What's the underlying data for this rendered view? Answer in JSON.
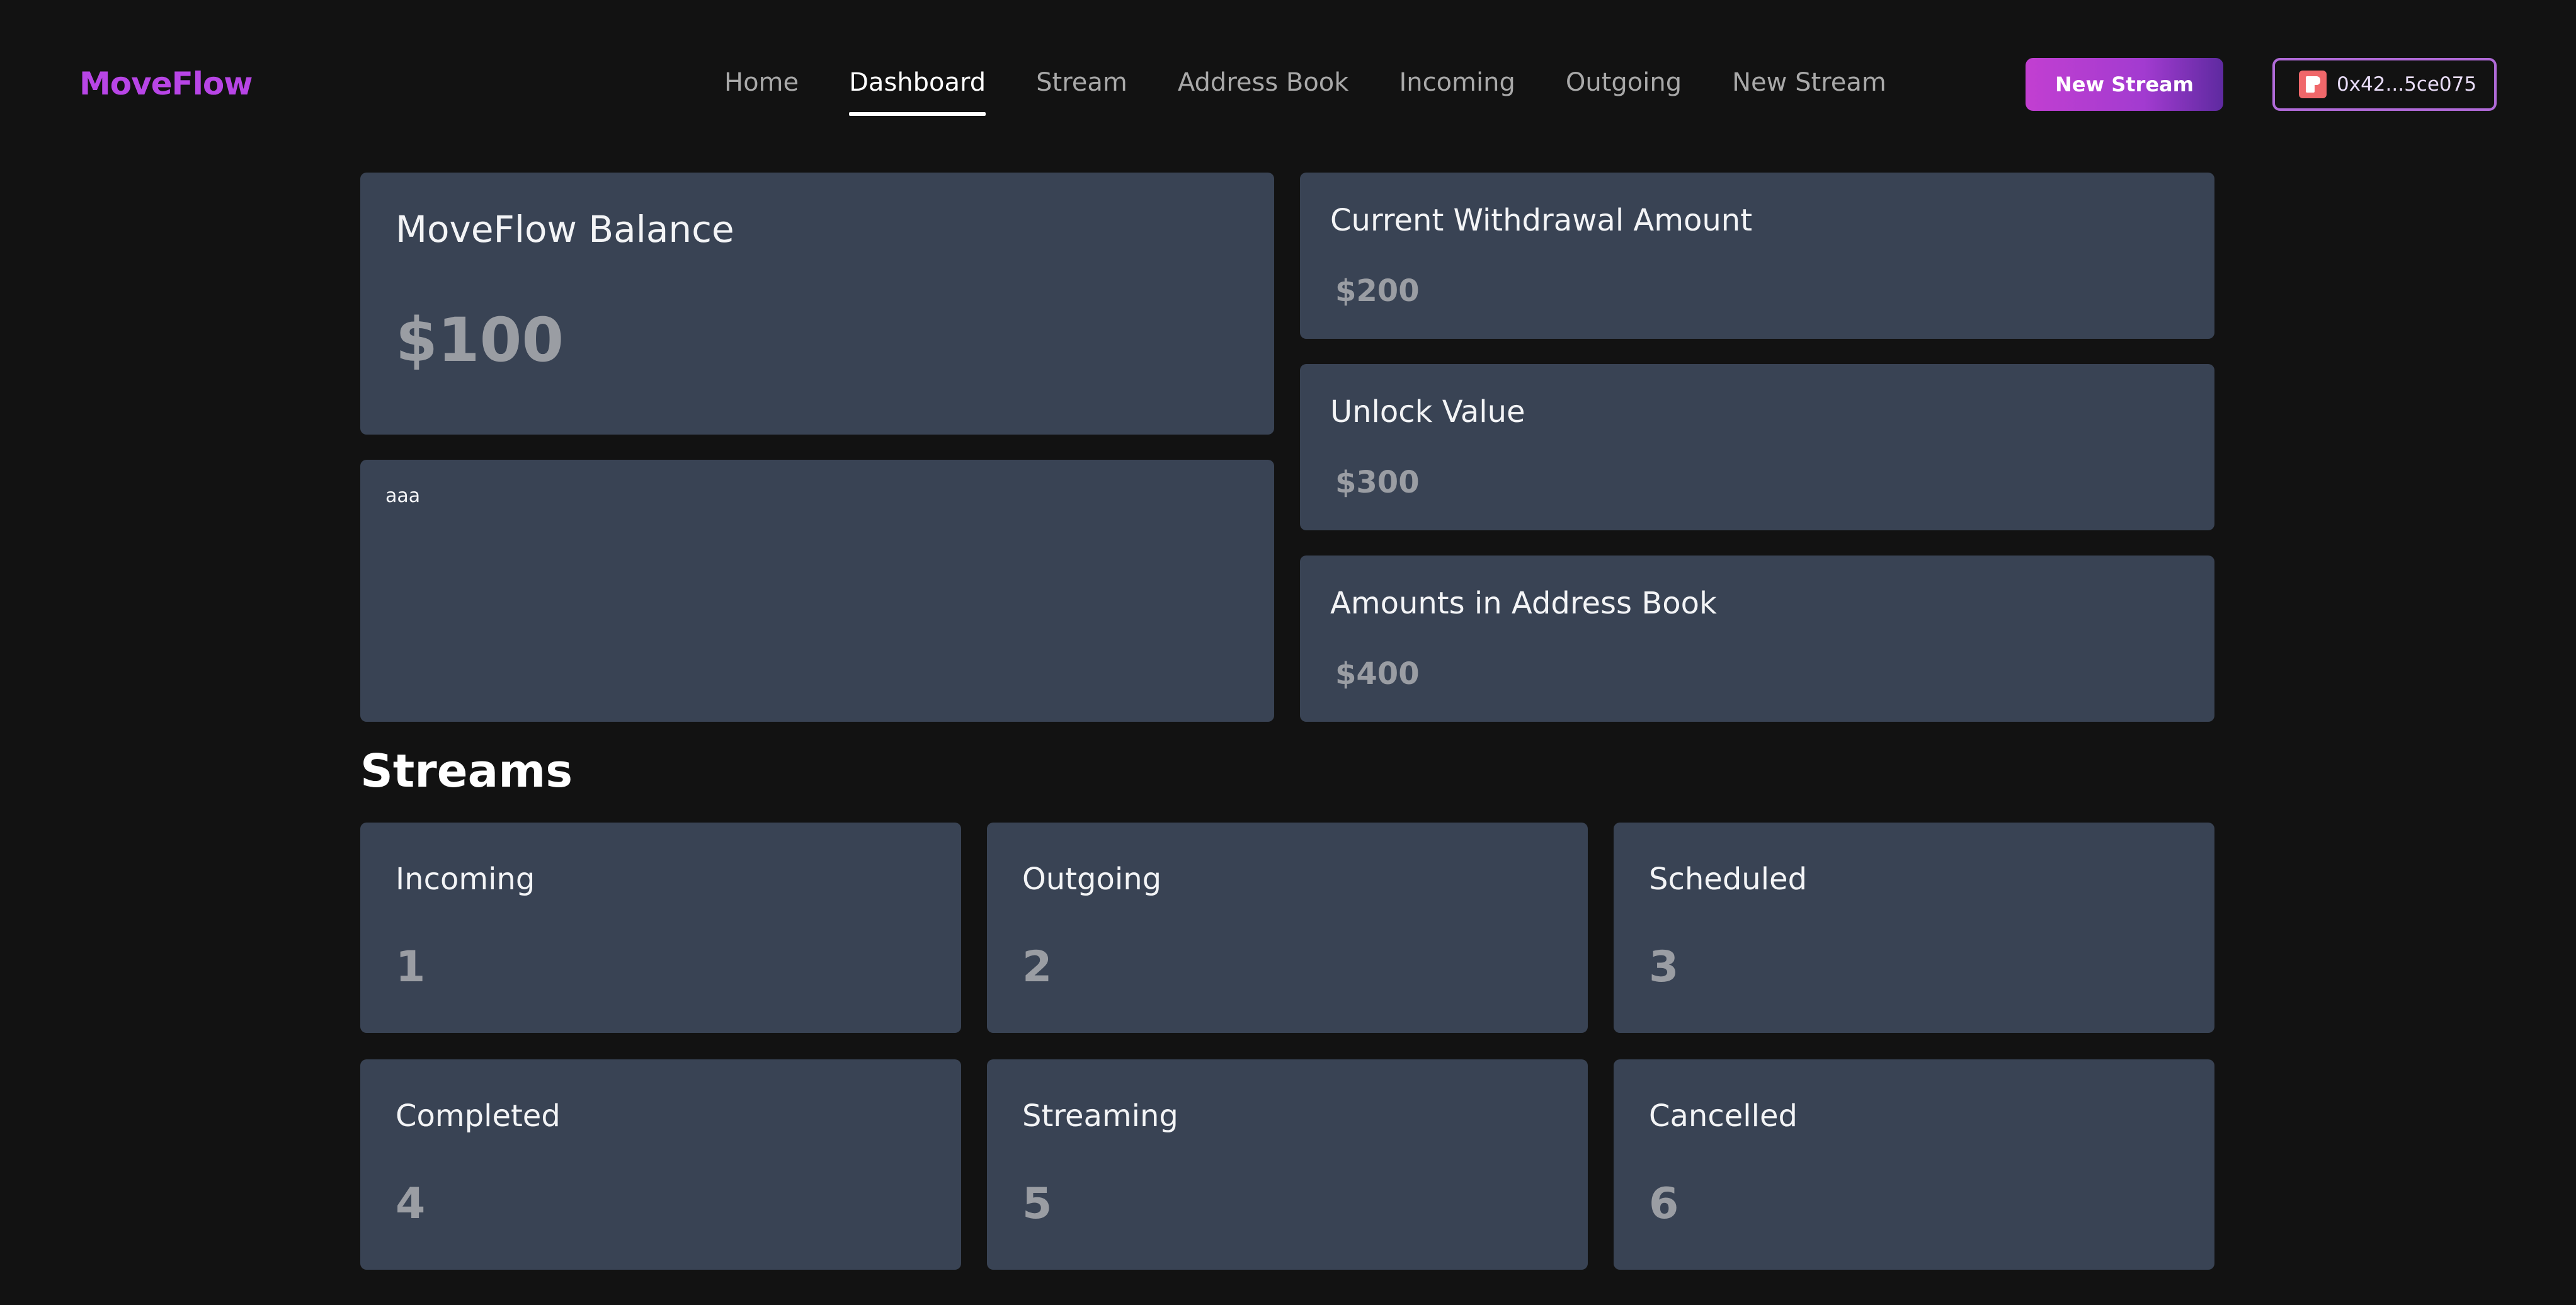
{
  "header": {
    "logo": "MoveFlow",
    "nav": [
      {
        "label": "Home",
        "active": false
      },
      {
        "label": "Dashboard",
        "active": true
      },
      {
        "label": "Stream",
        "active": false
      },
      {
        "label": "Address Book",
        "active": false
      },
      {
        "label": "Incoming",
        "active": false
      },
      {
        "label": "Outgoing",
        "active": false
      },
      {
        "label": "New Stream",
        "active": false
      }
    ],
    "new_stream_button": "New Stream",
    "wallet_address": "0x42...5ce075",
    "wallet_icon": "wallet-logo-icon"
  },
  "colors": {
    "background": "#121212",
    "card": "#394354",
    "accent": "#b845e6",
    "button_gradient_start": "#c23fd1",
    "button_gradient_end": "#5e2aa0",
    "muted_value": "#9a9da3"
  },
  "balance": {
    "title": "MoveFlow Balance",
    "value": "$100"
  },
  "note": {
    "text": "aaa"
  },
  "stats": [
    {
      "title": "Current Withdrawal Amount",
      "value": "$200"
    },
    {
      "title": "Unlock Value",
      "value": "$300"
    },
    {
      "title": "Amounts in Address Book",
      "value": "$400"
    }
  ],
  "streams": {
    "title": "Streams",
    "items": [
      {
        "title": "Incoming",
        "value": "1"
      },
      {
        "title": "Outgoing",
        "value": "2"
      },
      {
        "title": "Scheduled",
        "value": "3"
      },
      {
        "title": "Completed",
        "value": "4"
      },
      {
        "title": "Streaming",
        "value": "5"
      },
      {
        "title": "Cancelled",
        "value": "6"
      }
    ]
  }
}
